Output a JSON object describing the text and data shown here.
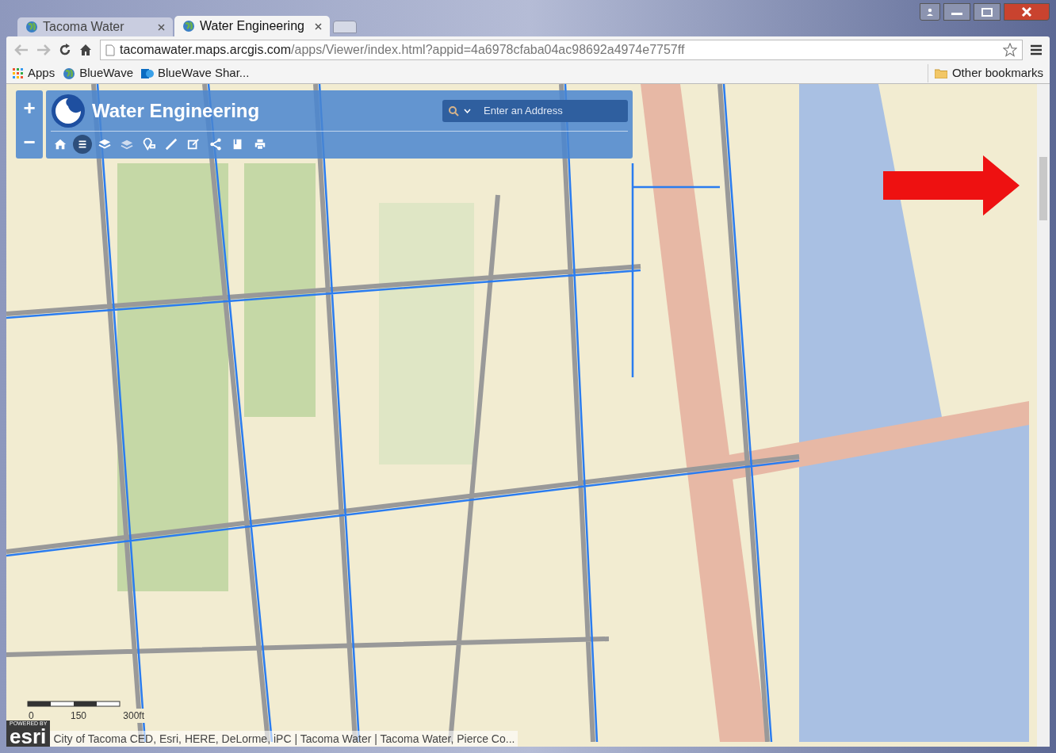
{
  "tabs": [
    {
      "title": "Tacoma Water",
      "selected": false
    },
    {
      "title": "Water Engineering",
      "selected": true
    }
  ],
  "address_bar": {
    "host": "tacomawater.maps.arcgis.com",
    "path": "/apps/Viewer/index.html?appid=4a6978cfaba04ac98692a4974e7757ff"
  },
  "bookmarks": [
    {
      "label": "Apps",
      "kind": "apps"
    },
    {
      "label": "BlueWave",
      "kind": "globe"
    },
    {
      "label": "BlueWave Shar...",
      "kind": "sharepoint"
    }
  ],
  "other_bookmarks": "Other bookmarks",
  "map_app": {
    "title": "Water Engineering",
    "search": {
      "placeholder": "Enter an Address"
    },
    "zoom_in": "+",
    "zoom_out": "−",
    "tools": [
      {
        "kind": "home",
        "selected": false
      },
      {
        "kind": "list",
        "selected": true
      },
      {
        "kind": "layers",
        "selected": false
      },
      {
        "kind": "basemap",
        "selected": false
      },
      {
        "kind": "locate",
        "selected": false
      },
      {
        "kind": "measure",
        "selected": false
      },
      {
        "kind": "edit",
        "selected": false
      },
      {
        "kind": "share",
        "selected": false
      },
      {
        "kind": "bookmark",
        "selected": false
      },
      {
        "kind": "print",
        "selected": false
      }
    ],
    "scale_labels": [
      "0",
      "150",
      "300ft"
    ],
    "powered_by": "POWERED BY",
    "esri": "esri",
    "attribution": "City of Tacoma CED, Esri, HERE, DeLorme, iPC | Tacoma Water | Tacoma Water, Pierce Co..."
  }
}
